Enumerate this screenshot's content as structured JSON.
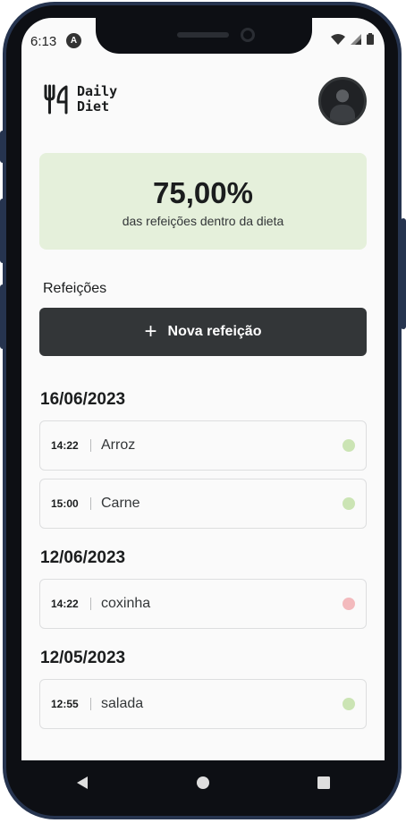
{
  "status": {
    "time": "6:13",
    "a_icon": "A"
  },
  "app": {
    "logo_line1": "Daily",
    "logo_line2": "Diet"
  },
  "stats": {
    "percentage": "75,00%",
    "label": "das refeições dentro da dieta",
    "color": "#e5f0db"
  },
  "meals_section": {
    "title": "Refeições",
    "new_button": "Nova refeição"
  },
  "days": [
    {
      "date": "16/06/2023",
      "meals": [
        {
          "time": "14:22",
          "name": "Arroz",
          "in_diet": true
        },
        {
          "time": "15:00",
          "name": "Carne",
          "in_diet": true
        }
      ]
    },
    {
      "date": "12/06/2023",
      "meals": [
        {
          "time": "14:22",
          "name": "coxinha",
          "in_diet": false
        }
      ]
    },
    {
      "date": "12/05/2023",
      "meals": [
        {
          "time": "12:55",
          "name": "salada",
          "in_diet": true
        }
      ]
    }
  ],
  "colors": {
    "in_diet": "#cbe4b4",
    "out_diet": "#f3babd",
    "button": "#333638"
  },
  "icons": {
    "back": "back-triangle-icon",
    "home": "home-circle-icon",
    "recents": "recents-square-icon"
  }
}
